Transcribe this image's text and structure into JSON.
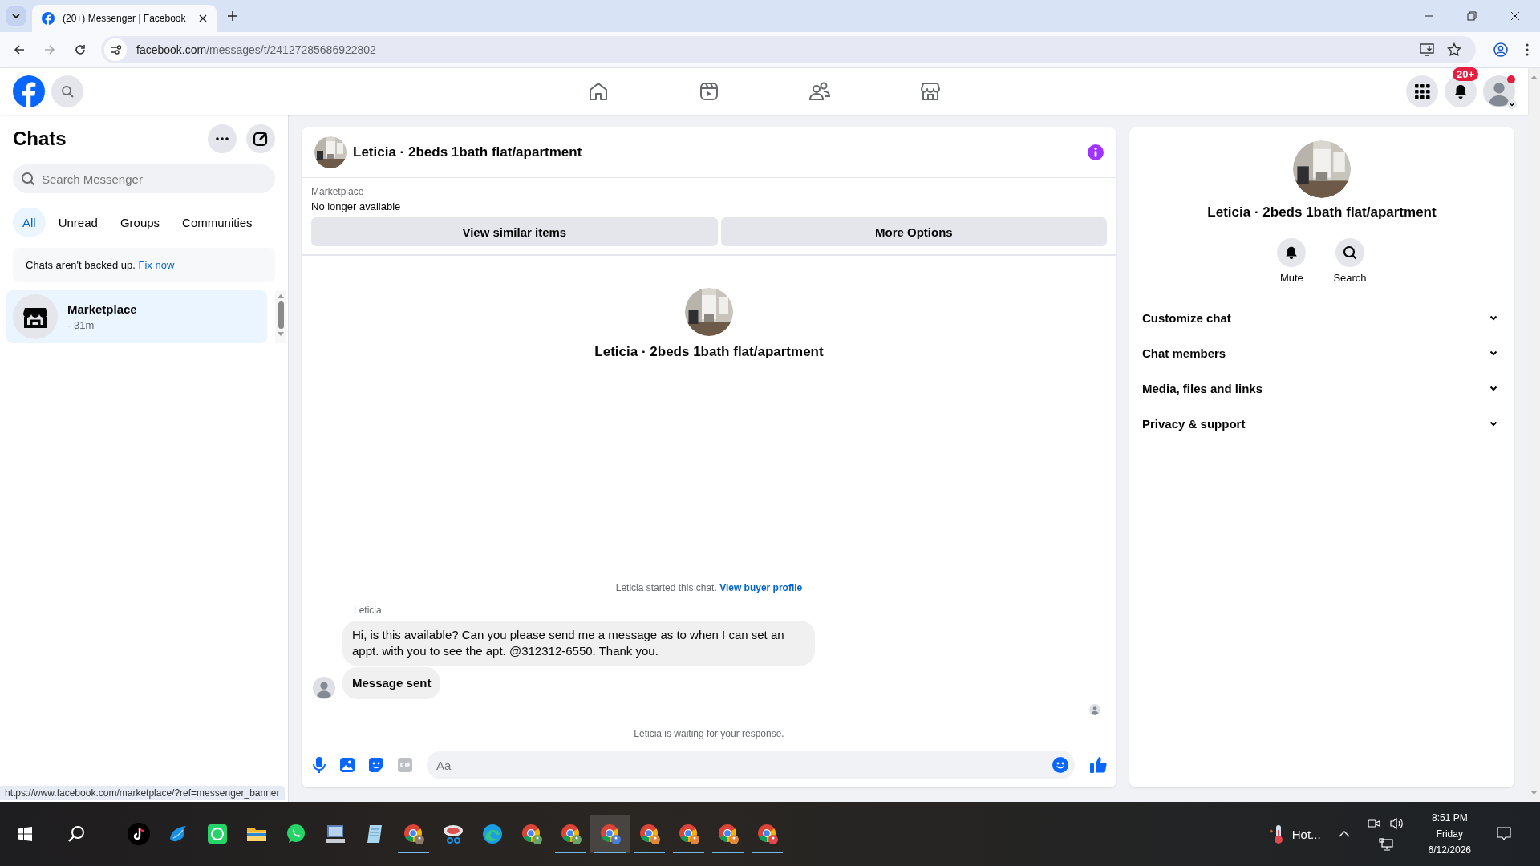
{
  "browser": {
    "tab_title": "(20+) Messenger | Facebook",
    "url_host": "facebook.com",
    "url_path": "/messages/t/24127285686922802"
  },
  "header": {
    "nav": [
      {
        "kind": "home"
      },
      {
        "kind": "video"
      },
      {
        "kind": "friends"
      },
      {
        "kind": "store"
      }
    ],
    "notification_badge": "20+"
  },
  "sidebar": {
    "title": "Chats",
    "search_placeholder": "Search Messenger",
    "filters": [
      {
        "label": "All",
        "selected": true
      },
      {
        "label": "Unread",
        "selected": false
      },
      {
        "label": "Groups",
        "selected": false
      },
      {
        "label": "Communities",
        "selected": false
      }
    ],
    "backup_notice": "Chats aren't backed up.",
    "backup_link": "Fix now",
    "chats": [
      {
        "name": "Marketplace",
        "time": "· 31m",
        "selected": true
      }
    ]
  },
  "conversation": {
    "title": "Leticia · 2beds 1bath flat/apartment",
    "listing_label": "Marketplace",
    "listing_status": "No longer available",
    "actions": [
      "View similar items",
      "More Options"
    ],
    "intro_title": "Leticia · 2beds 1bath flat/apartment",
    "started_note": "Leticia started this chat.",
    "started_link": "View buyer profile",
    "sender": "Leticia",
    "messages": [
      {
        "kind": "text",
        "text": "Hi, is this available? Can you please send me a message as to when I can set an appt. with you to see the apt. @312312-6550. Thank you."
      },
      {
        "kind": "status",
        "text": "Message sent"
      }
    ],
    "waiting_note": "Leticia is waiting for your response.",
    "composer_placeholder": "Aa"
  },
  "details": {
    "title": "Leticia · 2beds 1bath flat/apartment",
    "actions": [
      {
        "kind": "mute",
        "label": "Mute"
      },
      {
        "kind": "search",
        "label": "Search"
      }
    ],
    "sections": [
      {
        "label": "Customize chat",
        "expanded": false
      },
      {
        "label": "Chat members",
        "expanded": false
      },
      {
        "label": "Media, files and links",
        "expanded": false
      },
      {
        "label": "Privacy & support",
        "expanded": false
      }
    ]
  },
  "status_url": "https://www.facebook.com/marketplace/?ref=messenger_banner",
  "taskbar": {
    "apps": [
      {
        "kind": "tiktok",
        "running": false,
        "selected": false
      },
      {
        "kind": "bird",
        "running": false,
        "selected": false
      },
      {
        "kind": "chat-square",
        "running": false,
        "selected": false
      },
      {
        "kind": "folder",
        "running": false,
        "selected": false
      },
      {
        "kind": "whatsapp",
        "running": false,
        "selected": false
      },
      {
        "kind": "computer",
        "running": false,
        "selected": false
      },
      {
        "kind": "notepad",
        "running": false,
        "selected": false
      },
      {
        "kind": "chrome",
        "running": true,
        "selected": false,
        "color": "#8a7a6a"
      },
      {
        "kind": "scissors",
        "running": false,
        "selected": false
      },
      {
        "kind": "edge",
        "running": false,
        "selected": false
      },
      {
        "kind": "chrome",
        "running": false,
        "selected": false,
        "color": "#6aa36a"
      },
      {
        "kind": "chrome",
        "running": true,
        "selected": false,
        "color": "#6aa36a"
      },
      {
        "kind": "chrome",
        "running": true,
        "selected": true,
        "color": "#4a7fd8"
      },
      {
        "kind": "chrome",
        "running": true,
        "selected": false,
        "color": "#e0893a"
      },
      {
        "kind": "chrome",
        "running": true,
        "selected": false,
        "color": "#e0893a"
      },
      {
        "kind": "chrome",
        "running": true,
        "selected": false,
        "color": "#e0893a"
      },
      {
        "kind": "chrome",
        "running": true,
        "selected": false,
        "color": "#e0474f"
      }
    ],
    "weather": "Hot...",
    "time": "8:51 PM",
    "day": "Friday",
    "date": "6/12/2026"
  }
}
